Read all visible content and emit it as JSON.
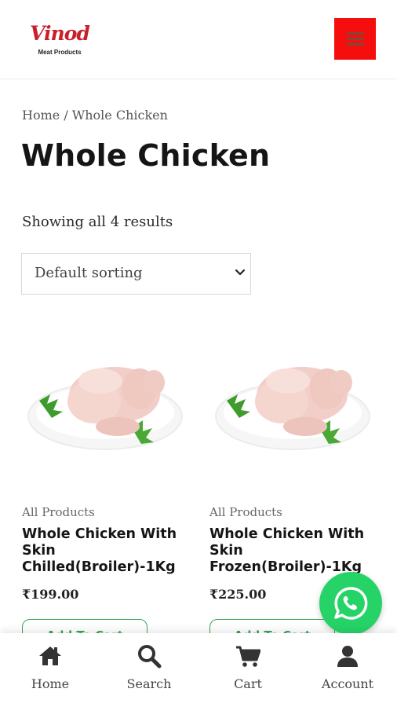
{
  "header": {
    "logo_text": "Vinod",
    "logo_subtext": "Meat Products",
    "menu_icon": "hamburger-icon",
    "brand_color": "#f50e0e"
  },
  "breadcrumb": {
    "home": "Home",
    "separator": " / ",
    "current": "Whole Chicken"
  },
  "page": {
    "title": "Whole Chicken",
    "result_count": "Showing all 4 results",
    "sort_selected": "Default sorting"
  },
  "products": [
    {
      "category": "All Products",
      "name": "Whole Chicken With Skin Chilled(Broiler)-1Kg",
      "price": "₹199.00",
      "button": "Add To Cart"
    },
    {
      "category": "All Products",
      "name": "Whole Chicken With Skin Frozen(Broiler)-1Kg",
      "price": "₹225.00",
      "button": "Add To Cart"
    }
  ],
  "bottom_nav": [
    {
      "label": "Home",
      "icon": "home-icon"
    },
    {
      "label": "Search",
      "icon": "search-icon"
    },
    {
      "label": "Cart",
      "icon": "cart-icon"
    },
    {
      "label": "Account",
      "icon": "user-icon"
    }
  ],
  "whatsapp": {
    "icon": "whatsapp-icon",
    "color": "#26d367"
  }
}
